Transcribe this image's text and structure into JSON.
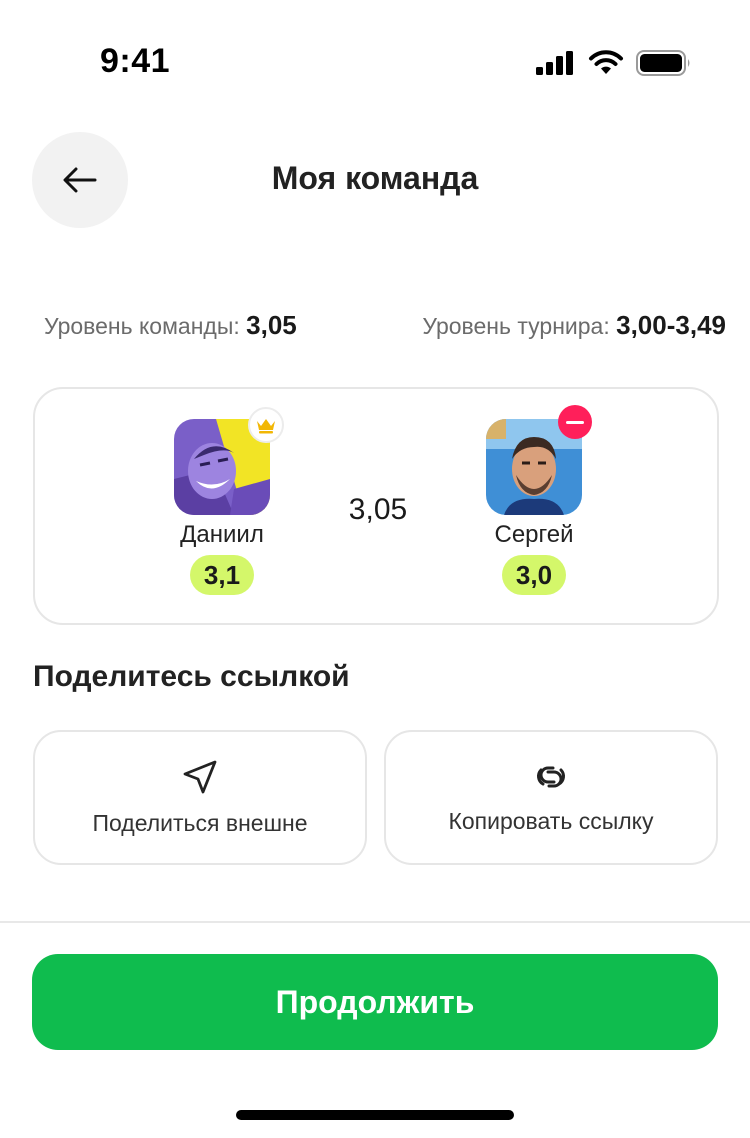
{
  "status_bar": {
    "time": "9:41"
  },
  "header": {
    "title": "Моя команда"
  },
  "levels": {
    "team_label": "Уровень команды:",
    "team_value": "3,05",
    "tournament_label": "Уровень турнира:",
    "tournament_value": "3,00-3,49"
  },
  "team": {
    "average": "3,05",
    "players": [
      {
        "name": "Даниил",
        "rating": "3,1"
      },
      {
        "name": "Сергей",
        "rating": "3,0"
      }
    ]
  },
  "share": {
    "title": "Поделитесь ссылкой",
    "external_label": "Поделиться внешне",
    "copy_label": "Копировать ссылку"
  },
  "footer": {
    "continue_label": "Продолжить"
  },
  "colors": {
    "accent_green": "#0fbc4e",
    "rating_badge": "#d4f76a",
    "remove_red": "#ff1f5a",
    "crown_gold": "#f2b705"
  }
}
